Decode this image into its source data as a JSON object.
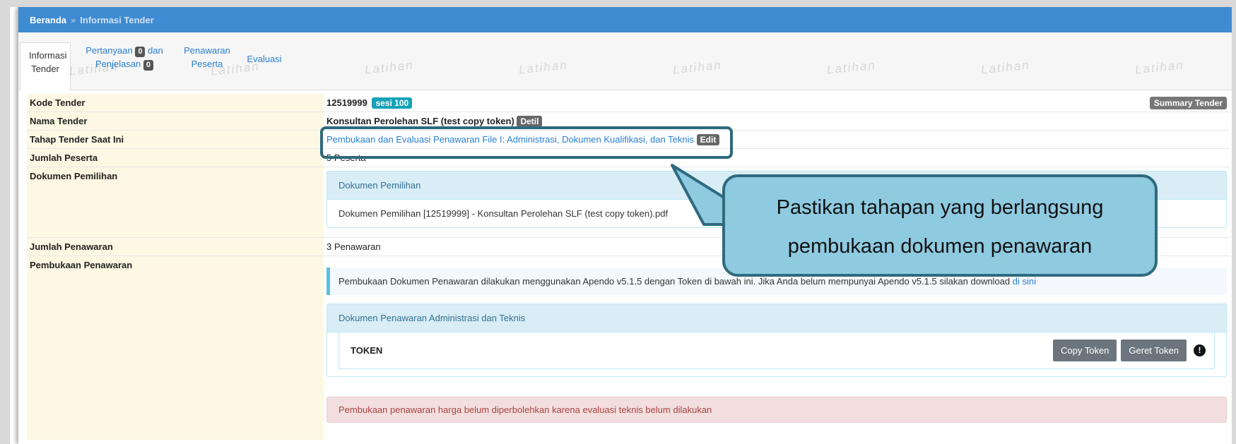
{
  "breadcrumb": {
    "home": "Beranda",
    "separator": "»",
    "current": "Informasi Tender"
  },
  "tabs": [
    {
      "line1": "Informasi",
      "line2": "Tender"
    },
    {
      "line1_text": "Pertanyaan",
      "line1_badge": "0",
      "line1_tail": "dan",
      "line2_text": "Penjelasan",
      "line2_badge": "0"
    },
    {
      "line1": "Penawaran",
      "line2": "Peserta"
    },
    {
      "line1": "Evaluasi"
    }
  ],
  "watermark": "Latihan",
  "rows": {
    "kode": {
      "label": "Kode Tender",
      "value": "12519999",
      "badge": "sesi 100",
      "summary_button": "Summary Tender"
    },
    "nama": {
      "label": "Nama Tender",
      "value": "Konsultan Perolehan SLF (test copy token)",
      "button": "Detil"
    },
    "tahap": {
      "label": "Tahap Tender Saat Ini",
      "value": "Pembukaan dan Evaluasi Penawaran File I: Administrasi, Dokumen Kualifikasi, dan Teknis",
      "button": "Edit"
    },
    "peserta": {
      "label": "Jumlah Peserta",
      "value": "5 Peserta"
    },
    "dokumen": {
      "label": "Dokumen Pemilihan",
      "panel_title": "Dokumen Pemilihan",
      "file": "Dokumen Pemilihan [12519999] - Konsultan Perolehan SLF (test copy token).pdf"
    },
    "penawaran": {
      "label": "Jumlah Penawaran",
      "value": "3 Penawaran"
    },
    "pembukaan": {
      "label": "Pembukaan Penawaran",
      "info_text": "Pembukaan Dokumen Penawaran dilakukan menggunakan Apendo v5.1.5 dengan Token di bawah ini. Jika Anda belum mempunyai Apendo v5.1.5 silakan download",
      "info_link": "di sini",
      "panel_title": "Dokumen Penawaran Administrasi dan Teknis",
      "token_label": "TOKEN",
      "copy_button": "Copy Token",
      "generate_button": "Geret Token",
      "alert": "Pembukaan penawaran harga belum diperbolehkan karena evaluasi teknis belum dilakukan"
    }
  },
  "callout": {
    "line1": "Pastikan tahapan yang berlangsung",
    "line2": "pembukaan dokumen penawaran"
  },
  "colors": {
    "header": "#3f8bd1",
    "label_bg": "#fcf8e3",
    "callout_bg": "#8ecae0",
    "callout_border": "#2f6a7e"
  }
}
